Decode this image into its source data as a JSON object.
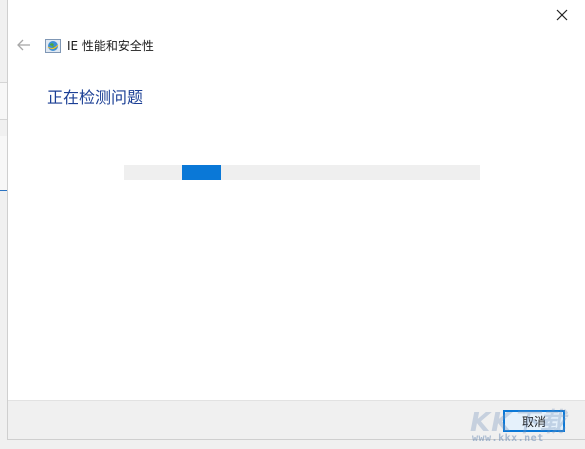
{
  "window": {
    "title": "IE 性能和安全性",
    "heading": "正在检测问题"
  },
  "progress": {
    "start_fraction": 0.163,
    "end_fraction": 0.272
  },
  "footer": {
    "cancel_label": "取消"
  },
  "watermark": {
    "text": "KK下载",
    "url": "www.kkx.net"
  },
  "icons": {
    "close": "close-icon",
    "back": "back-arrow-icon",
    "app": "ie-globe-icon"
  },
  "colors": {
    "accent": "#0a78d7",
    "heading": "#1b3f95",
    "footer_bg": "#f0f0f0",
    "track": "#efefef"
  }
}
